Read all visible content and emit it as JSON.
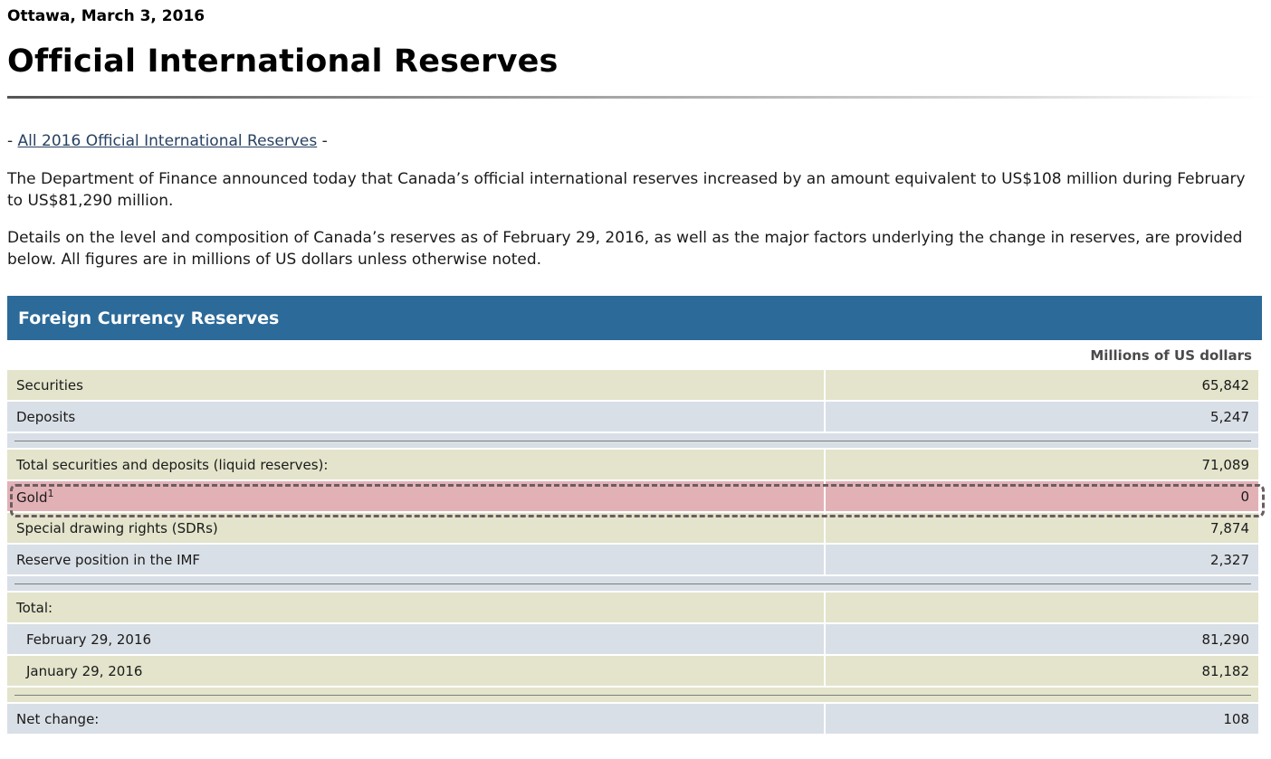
{
  "header": {
    "dateline": "Ottawa, March 3, 2016",
    "title": "Official International Reserves"
  },
  "links": {
    "prefix": "- ",
    "all_link": "All 2016 Official International Reserves",
    "suffix": " -"
  },
  "body": {
    "paragraph_1": "The Department of Finance announced today that Canada’s official international reserves increased by an amount equivalent to US$108 million during February to US$81,290 million.",
    "paragraph_2": "Details on the level and composition of Canada’s reserves as of February 29, 2016, as well as the major factors underlying the change in reserves, are provided below. All figures are in millions of US dollars unless otherwise noted."
  },
  "table": {
    "heading": "Foreign Currency Reserves",
    "units": "Millions of US dollars",
    "rows": {
      "securities": {
        "label": "Securities",
        "value": "65,842"
      },
      "deposits": {
        "label": "Deposits",
        "value": "5,247"
      },
      "total_liquid": {
        "label": "Total securities and deposits (liquid reserves):",
        "value": "71,089"
      },
      "gold": {
        "label": "Gold",
        "footnote": "1",
        "value": "0"
      },
      "sdr": {
        "label": "Special drawing rights (SDRs)",
        "value": "7,874"
      },
      "imf": {
        "label": "Reserve position in the IMF",
        "value": "2,327"
      },
      "total": {
        "label": "Total:",
        "value": ""
      },
      "feb": {
        "label": "February 29, 2016",
        "value": "81,290"
      },
      "jan": {
        "label": "January 29, 2016",
        "value": "81,182"
      },
      "net_change": {
        "label": "Net change:",
        "value": "108"
      }
    }
  },
  "colors": {
    "heading_bg": "#2c6a99",
    "row_tan": "#e3e4cb",
    "row_blue": "#d9dfe6",
    "highlight_row": "#e2b1b6",
    "link": "#284162"
  }
}
